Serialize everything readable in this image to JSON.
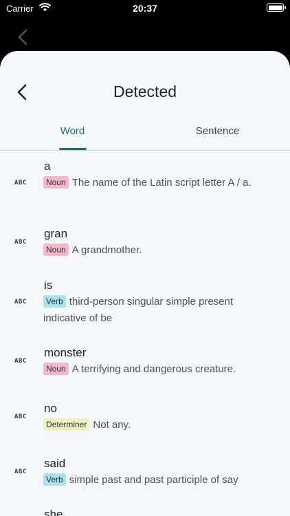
{
  "status": {
    "carrier": "Carrier",
    "time": "20:37"
  },
  "header": {
    "title": "Detected"
  },
  "tabs": [
    {
      "label": "Word",
      "active": true
    },
    {
      "label": "Sentence",
      "active": false
    }
  ],
  "icons": {
    "entry": "abc-icon",
    "abc_text": "ABC",
    "back": "chevron-left-icon"
  },
  "colors": {
    "accent": "#1f6b70",
    "noun": "#f6b8c9",
    "verb": "#a8e3ec",
    "determiner": "#f0f2bd"
  },
  "entries": [
    {
      "word": "a",
      "pos": "Noun",
      "definition": "The name of the Latin script letter A / a."
    },
    {
      "word": "gran",
      "pos": "Noun",
      "definition": "A grandmother."
    },
    {
      "word": "is",
      "pos": "Verb",
      "definition": "third-person singular simple present indicative of be"
    },
    {
      "word": "monster",
      "pos": "Noun",
      "definition": "A terrifying and dangerous creature."
    },
    {
      "word": "no",
      "pos": "Determiner",
      "definition": "Not any."
    },
    {
      "word": "said",
      "pos": "Verb",
      "definition": "simple past and past participle of say"
    },
    {
      "word": "she",
      "pos": "",
      "definition": ""
    }
  ]
}
